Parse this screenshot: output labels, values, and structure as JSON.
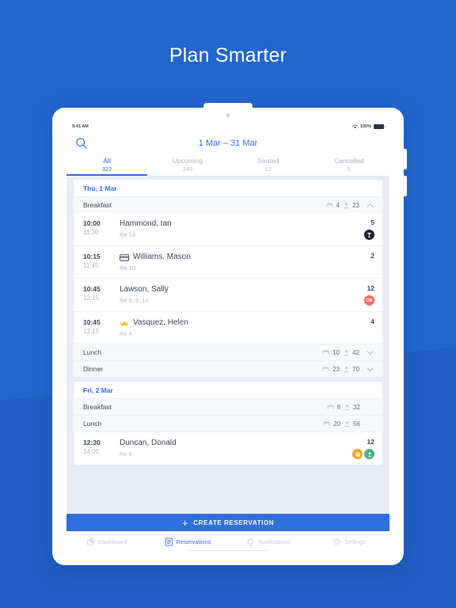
{
  "hero": {
    "title": "Plan Smarter"
  },
  "colors": {
    "background": "#2266cf",
    "background_band": "#1f5fc4",
    "accent": "#2f6fe0",
    "text_dark": "#3c4659",
    "text_muted": "#aab2c0",
    "badge_ob": "#f56b62",
    "badge_note": "#f5a623",
    "badge_guest": "#4caf82",
    "badge_dark": "#1c2330",
    "vip_crown": "#f5c430",
    "panel_bg": "#e8ecf7"
  },
  "statusbar": {
    "time": "9:41 AM",
    "battery_label": "100%",
    "wifi_icon": "wifi-icon",
    "battery_icon": "battery-icon"
  },
  "header": {
    "search_icon": "search-icon",
    "date_range": "1 Mar – 31 Mar"
  },
  "tabs": [
    {
      "label": "All",
      "count": "322",
      "active": true
    },
    {
      "label": "Upcoming",
      "count": "245",
      "active": false
    },
    {
      "label": "Seated",
      "count": "12",
      "active": false
    },
    {
      "label": "Cancelled",
      "count": "5",
      "active": false
    }
  ],
  "days": [
    {
      "date_label": "Thu, 1 Mar",
      "sections": [
        {
          "meal": "Breakfast",
          "tables": "4",
          "guests": "23",
          "expanded": true,
          "chevron": "chevron-up-icon",
          "reservations": [
            {
              "start": "10:00",
              "end": "11:30",
              "name": "Hammond, Ian",
              "sub": "Re 14",
              "covers": "5",
              "name_icon": "",
              "badges": [
                {
                  "type": "dark",
                  "icon": "dining-icon",
                  "text": ""
                }
              ]
            },
            {
              "start": "10:15",
              "end": "11:45",
              "name": "Williams, Mason",
              "sub": "Re 10",
              "covers": "2",
              "name_icon": "credit-card-icon",
              "badges": []
            },
            {
              "start": "10:45",
              "end": "12:15",
              "name": "Lawson, Sally",
              "sub": "Re 8, 9, 10",
              "covers": "12",
              "name_icon": "",
              "badges": [
                {
                  "type": "ob",
                  "icon": "",
                  "text": "OB"
                }
              ]
            },
            {
              "start": "10:45",
              "end": "12:15",
              "name": "Vasquez, Helen",
              "sub": "Re 4",
              "covers": "4",
              "name_icon": "crown-icon",
              "badges": []
            }
          ]
        },
        {
          "meal": "Lunch",
          "tables": "10",
          "guests": "42",
          "expanded": false,
          "chevron": "chevron-down-icon",
          "reservations": []
        },
        {
          "meal": "Dinner",
          "tables": "23",
          "guests": "70",
          "expanded": false,
          "chevron": "chevron-down-icon",
          "reservations": []
        }
      ]
    },
    {
      "date_label": "Fri, 2 Mar",
      "sections": [
        {
          "meal": "Breakfast",
          "tables": "8",
          "guests": "32",
          "expanded": false,
          "chevron": "",
          "reservations": []
        },
        {
          "meal": "Lunch",
          "tables": "20",
          "guests": "56",
          "expanded": false,
          "chevron": "",
          "reservations": [
            {
              "start": "12:30",
              "end": "14:00",
              "name": "Duncan, Donald",
              "sub": "Re 8",
              "covers": "12",
              "name_icon": "",
              "badges": [
                {
                  "type": "note",
                  "icon": "note-icon",
                  "text": ""
                },
                {
                  "type": "guest",
                  "icon": "guest-icon",
                  "text": ""
                }
              ]
            }
          ]
        }
      ]
    }
  ],
  "create_button": {
    "label": "CREATE RESERVATION",
    "icon": "plus-icon"
  },
  "bottom_nav": [
    {
      "label": "Dashboard",
      "icon": "dashboard-icon",
      "active": false
    },
    {
      "label": "Reservations",
      "icon": "reservations-icon",
      "active": true
    },
    {
      "label": "Notifications",
      "icon": "bell-icon",
      "active": false
    },
    {
      "label": "Settings",
      "icon": "gear-icon",
      "active": false
    }
  ]
}
